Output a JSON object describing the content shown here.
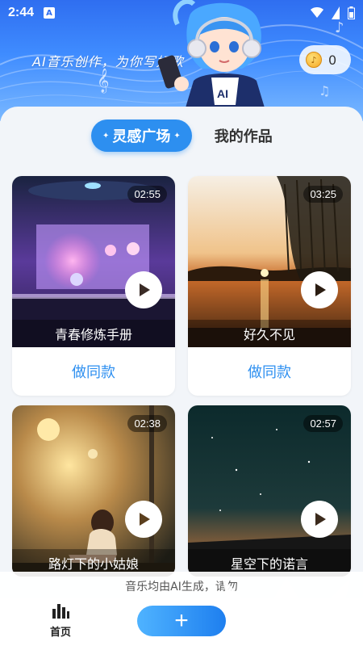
{
  "statusbar": {
    "time": "2:44",
    "badge": "A",
    "wifi": "wifi-icon",
    "battery": "battery-icon"
  },
  "banner": {
    "slogan": "AI音乐创作，为你写好歌",
    "coins": "0",
    "mascot_badge": "AI"
  },
  "tabs": {
    "active": "灵感广场",
    "other": "我的作品"
  },
  "cards": [
    {
      "title": "青春修炼手册",
      "duration": "02:55",
      "action": "做同款"
    },
    {
      "title": "好久不见",
      "duration": "03:25",
      "action": "做同款"
    },
    {
      "title": "路灯下的小姑娘",
      "duration": "02:38"
    },
    {
      "title": "星空下的诺言",
      "duration": "02:57"
    }
  ],
  "notice": "音乐均由AI生成，请勿",
  "nav": {
    "home": "首页",
    "create": "+"
  },
  "colors": {
    "accent": "#2d8ff0",
    "banner": "#3f8cff"
  }
}
